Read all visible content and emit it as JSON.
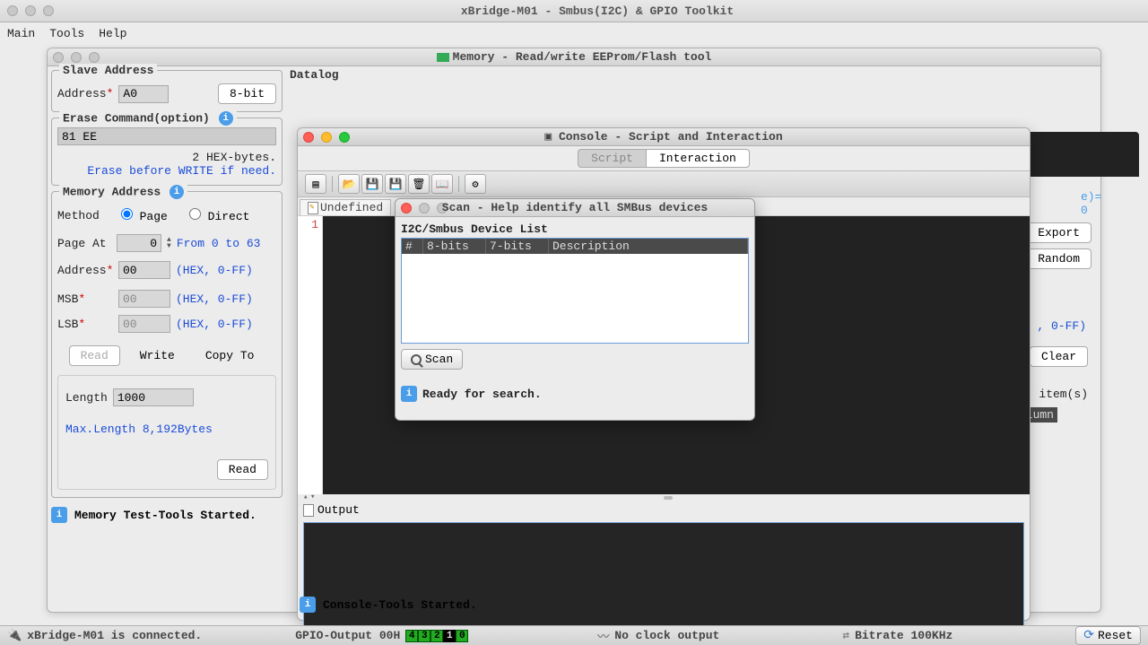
{
  "app": {
    "title": "xBridge-M01 - Smbus(I2C) & GPIO Toolkit",
    "menu": [
      "Main",
      "Tools",
      "Help"
    ]
  },
  "memory_window": {
    "title": "Memory - Read/write EEProm/Flash tool",
    "slave_address": {
      "title": "Slave Address",
      "address_label": "Address",
      "address_value": "A0",
      "bits_btn": "8-bit"
    },
    "erase": {
      "title": "Erase Command(option)",
      "value": "81 EE",
      "hex_bytes": "2 HEX-bytes.",
      "warn": "Erase before WRITE if need."
    },
    "mem_addr": {
      "title": "Memory Address",
      "method_label": "Method",
      "page_label": "Page",
      "direct_label": "Direct",
      "page_at_label": "Page At",
      "page_at_value": "0",
      "page_range": "From 0 to 63",
      "addr_label": "Address",
      "addr_value": "00",
      "msb_label": "MSB",
      "msb_value": "00",
      "lsb_label": "LSB",
      "lsb_value": "00",
      "hex_hint": "(HEX, 0-FF)",
      "read_btn": "Read",
      "write_btn": "Write",
      "copy_btn": "Copy To",
      "length_label": "Length",
      "length_value": "1000",
      "max_len": "Max.Length 8,192Bytes",
      "read2_btn": "Read"
    },
    "status": "Memory Test-Tools Started.",
    "right": {
      "export": "Export",
      "random": "Random",
      "hex_hint": ", 0-FF)",
      "clear": "Clear",
      "items": "item(s)",
      "lumn": "lumn",
      "e0": "e)= 0"
    }
  },
  "datalog": "Datalog",
  "console": {
    "title": "Console - Script and Interaction",
    "tabs": [
      "Script",
      "Interaction"
    ],
    "script_tab": "Undefined",
    "line": "1",
    "output_title": "Output",
    "status": "Console-Tools Started."
  },
  "scan": {
    "title": "Scan - Help identify all SMBus devices",
    "subtitle": "I2C/Smbus Device List",
    "cols": [
      "#",
      "8-bits",
      "7-bits",
      "Description"
    ],
    "btn": "Scan",
    "status": "Ready for search."
  },
  "statusbar": {
    "connected": "xBridge-M01 is connected.",
    "gpio": "GPIO-Output 00H",
    "bits": [
      "4",
      "3",
      "2",
      "1",
      "0"
    ],
    "bits_on": [
      true,
      true,
      true,
      false,
      true
    ],
    "clock": "No clock output",
    "bitrate": "Bitrate 100KHz",
    "reset": "Reset"
  }
}
